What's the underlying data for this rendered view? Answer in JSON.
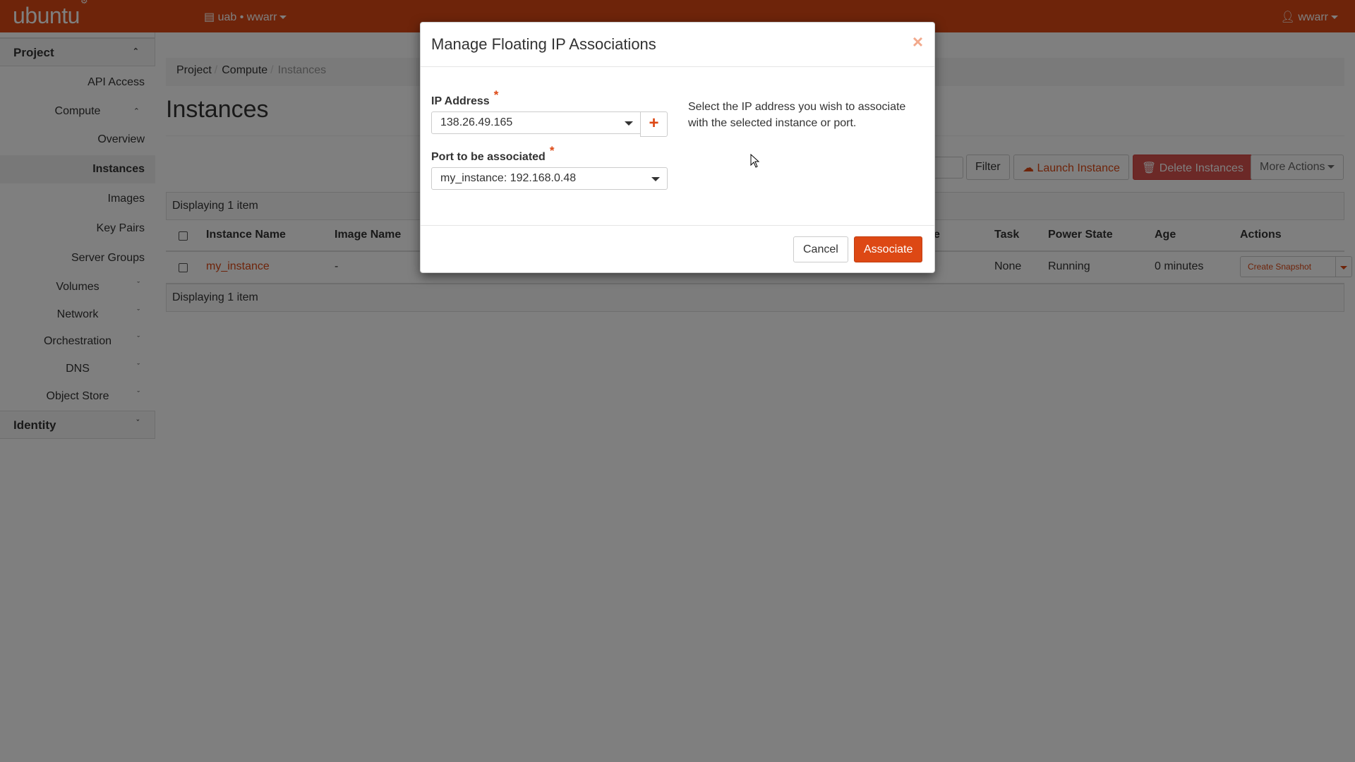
{
  "topbar": {
    "brand": "ubuntu",
    "project_switcher": "uab • wwarr",
    "user": "wwarr"
  },
  "sidebar": {
    "project_label": "Project",
    "items": {
      "api_access": "API Access",
      "compute": "Compute",
      "overview": "Overview",
      "instances": "Instances",
      "images": "Images",
      "key_pairs": "Key Pairs",
      "server_groups": "Server Groups",
      "volumes": "Volumes",
      "network": "Network",
      "orchestration": "Orchestration",
      "dns": "DNS",
      "object_store": "Object Store"
    },
    "identity_label": "Identity"
  },
  "breadcrumb": [
    "Project",
    "Compute",
    "Instances"
  ],
  "page_title": "Instances",
  "toolbar": {
    "filter": "Filter",
    "launch": "Launch Instance",
    "delete": "Delete Instances",
    "more": "More Actions"
  },
  "table": {
    "summary": "Displaying 1 item",
    "columns": {
      "instance_name": "Instance Name",
      "image_name": "Image Name",
      "partial": "e",
      "task": "Task",
      "power_state": "Power State",
      "age": "Age",
      "actions": "Actions"
    },
    "row": {
      "instance_name": "my_instance",
      "image_name": "-",
      "task": "None",
      "power_state": "Running",
      "age": "0 minutes",
      "action": "Create Snapshot"
    }
  },
  "modal": {
    "title": "Manage Floating IP Associations",
    "close": "×",
    "ip_label": "IP Address",
    "ip_value": "138.26.49.165",
    "plus": "+",
    "port_label": "Port to be associated",
    "port_value": "my_instance: 192.168.0.48",
    "required_mark": "*",
    "help_text": "Select the IP address you wish to associate with the selected instance or port.",
    "cancel": "Cancel",
    "associate": "Associate"
  },
  "colors": {
    "brand": "#dd4814",
    "danger": "#d9534f"
  }
}
